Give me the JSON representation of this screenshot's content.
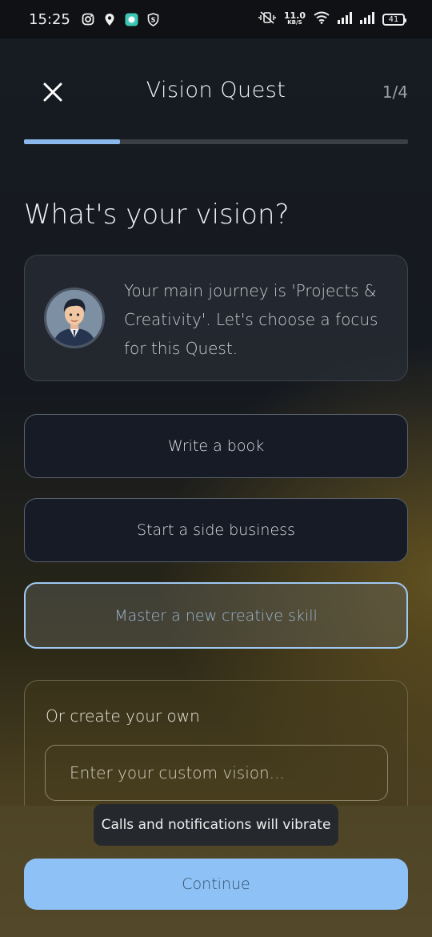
{
  "status_bar": {
    "time": "15:25",
    "left_icons": [
      "instagram-icon",
      "location-pin-icon",
      "chat-app-icon",
      "shield-s-icon"
    ],
    "net_speed_value": "11.0",
    "net_speed_unit": "KB/S",
    "battery": "41"
  },
  "header": {
    "title": "Vision Quest",
    "step": "1/4",
    "progress": 0.25
  },
  "question": "What's your vision?",
  "coach": {
    "message": "Your main journey is 'Projects & Creativity'. Let's choose a focus for this Quest."
  },
  "options": [
    {
      "label": "Write a book",
      "selected": false
    },
    {
      "label": "Start a side business",
      "selected": false
    },
    {
      "label": "Master a new creative skill",
      "selected": true
    }
  ],
  "custom": {
    "label": "Or create your own",
    "placeholder": "Enter your custom vision...",
    "value": ""
  },
  "toast": "Calls and notifications will vibrate",
  "continue_label": "Continue",
  "colors": {
    "accent": "#8ec2f6",
    "selected_border": "#9fc8f2",
    "background_dark": "#15191f",
    "background_gold": "#54482a"
  }
}
